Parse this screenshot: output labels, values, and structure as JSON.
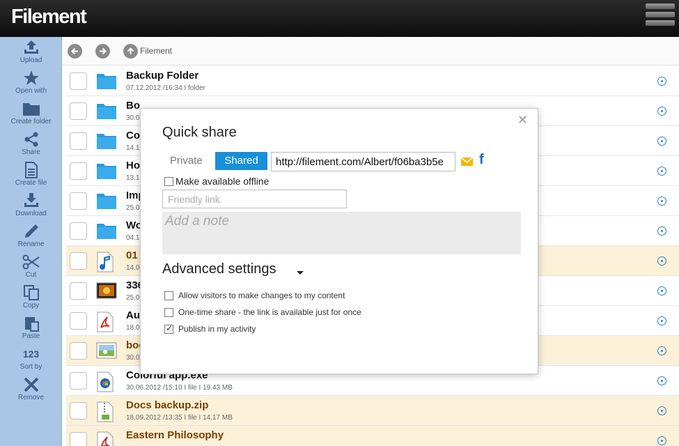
{
  "app": {
    "title": "Filement"
  },
  "sidebar": {
    "items": [
      {
        "label": "Upload",
        "icon": "upload-icon"
      },
      {
        "label": "Open with",
        "icon": "star-icon"
      },
      {
        "label": "Create folder",
        "icon": "folder-icon"
      },
      {
        "label": "Share",
        "icon": "share-icon"
      },
      {
        "label": "Create file",
        "icon": "file-icon"
      },
      {
        "label": "Download",
        "icon": "download-icon"
      },
      {
        "label": "Rename",
        "icon": "pencil-icon"
      },
      {
        "label": "Cut",
        "icon": "scissors-icon"
      },
      {
        "label": "Copy",
        "icon": "copy-icon"
      },
      {
        "label": "Paste",
        "icon": "paste-icon"
      },
      {
        "label": "Sort by",
        "icon_text": "123"
      },
      {
        "label": "Remove",
        "icon": "x-icon"
      }
    ]
  },
  "toolbar": {
    "breadcrumb": "Filement"
  },
  "files": [
    {
      "name": "Backup Folder",
      "meta": "07.12.2012 /16:34 I folder",
      "type": "folder",
      "highlight": false
    },
    {
      "name": "Bo",
      "meta": "30.0",
      "type": "folder",
      "highlight": false
    },
    {
      "name": "Co",
      "meta": "14.1",
      "type": "folder",
      "highlight": false
    },
    {
      "name": "Ho",
      "meta": "13.1",
      "type": "folder",
      "highlight": false
    },
    {
      "name": "Imp",
      "meta": "25.0",
      "type": "folder",
      "highlight": false
    },
    {
      "name": "Wo",
      "meta": "04.1",
      "type": "folder",
      "highlight": false
    },
    {
      "name": "01",
      "meta": "14.0",
      "type": "music",
      "highlight": true
    },
    {
      "name": "336",
      "meta": "25.0",
      "type": "image",
      "highlight": false
    },
    {
      "name": "Au",
      "meta": "18.0",
      "type": "pdf",
      "highlight": false
    },
    {
      "name": "boo",
      "meta": "30.0",
      "type": "photo",
      "highlight": true
    },
    {
      "name": "Colorful app.exe",
      "meta": "30.06.2012 /15:10 I file I 19.43 MB",
      "type": "exe",
      "highlight": false
    },
    {
      "name": "Docs backup.zip",
      "meta": "18.09.2012 /13:35 I file I 14.17 MB",
      "type": "zip",
      "highlight": true
    },
    {
      "name": "Eastern Philosophy",
      "meta": "",
      "type": "pdf",
      "highlight": true
    }
  ],
  "modal": {
    "title": "Quick share",
    "private_label": "Private",
    "shared_label": "Shared",
    "url": "http://filement.com/Albert/f06ba3b5e",
    "offline_label": "Make available offline",
    "offline_checked": false,
    "friendly_placeholder": "Friendly link",
    "note_placeholder": "Add a note",
    "advanced_label": "Advanced settings",
    "options": [
      {
        "label": "Allow visitors to make changes to my content",
        "checked": false
      },
      {
        "label": "One-time share - the link is available just for once",
        "checked": false
      },
      {
        "label": "Publish in my activity",
        "checked": true
      }
    ]
  },
  "colors": {
    "accent": "#1890d8",
    "sidebar": "#a9c6e6",
    "highlight_row": "#fbf1d8",
    "folder": "#2b9be0"
  }
}
